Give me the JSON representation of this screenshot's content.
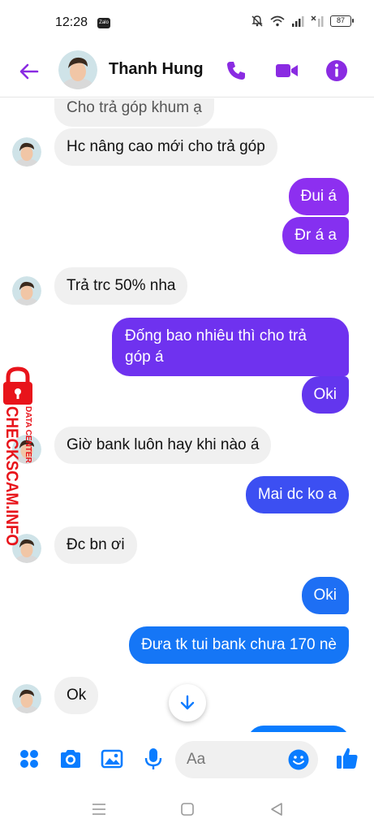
{
  "status_bar": {
    "time": "12:28",
    "notification_app": "Zalo",
    "battery": "87"
  },
  "header": {
    "contact_name": "Thanh Hung"
  },
  "messages": [
    {
      "text": "Cho trả góp khum ạ",
      "from": "them"
    },
    {
      "text": "Hc nâng cao mới cho trả góp",
      "from": "them"
    },
    {
      "text": "Đui á",
      "from": "me"
    },
    {
      "text": "Đr á a",
      "from": "me"
    },
    {
      "text": "Trả trc 50% nha",
      "from": "them"
    },
    {
      "text_line1": "Đống bao nhiêu thì cho trả",
      "text_line2": "góp á",
      "from": "me"
    },
    {
      "text": "Oki",
      "from": "me"
    },
    {
      "text": "Giờ bank luôn hay khi nào á",
      "from": "them"
    },
    {
      "text": "Mai dc ko a",
      "from": "me"
    },
    {
      "text": "Đc bn ơi",
      "from": "them"
    },
    {
      "text": "Oki",
      "from": "me"
    },
    {
      "text": "Đưa tk tui bank chưa 170 nè",
      "from": "me"
    },
    {
      "text": "Ok",
      "from": "them"
    }
  ],
  "watermark": {
    "brand": "CHECKSCAM.INFO",
    "tagline": "DATA CENTER"
  },
  "composer": {
    "placeholder": "Aa"
  },
  "icons": {
    "back": "arrow-left-icon",
    "call": "phone-icon",
    "video": "video-camera-icon",
    "info": "info-icon",
    "menu": "four-dots-icon",
    "camera": "camera-icon",
    "gallery": "image-icon",
    "mic": "microphone-icon",
    "emoji": "smiley-icon",
    "like": "thumbs-up-icon",
    "scroll": "arrow-down-icon"
  },
  "colors": {
    "accent_purple": "#8a2be2",
    "accent_blue": "#0a7cff",
    "incoming_bubble": "#f0f0f0",
    "watermark_red": "#e8141b"
  }
}
